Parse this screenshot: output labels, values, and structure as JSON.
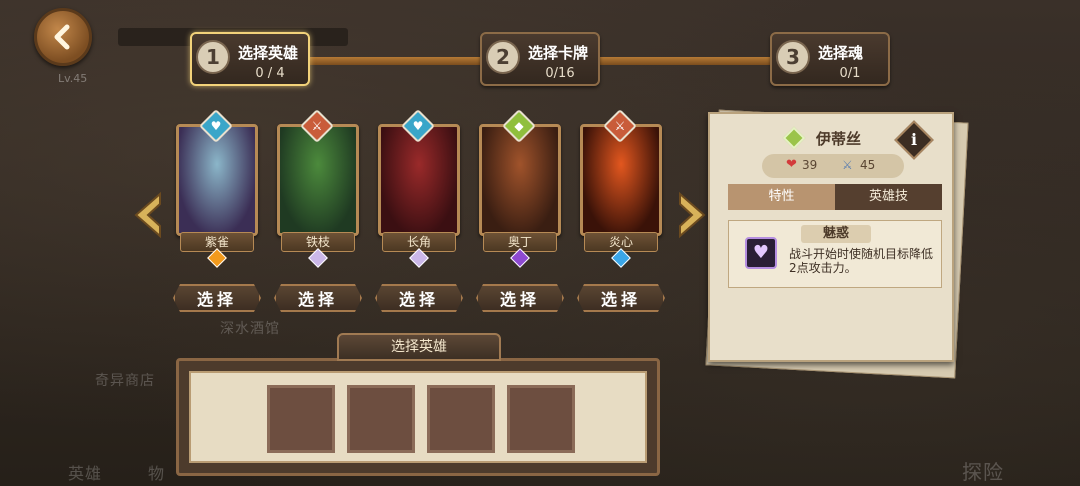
{
  "background": {
    "tavern": "深水酒馆",
    "shop": "奇异商店",
    "bottom_left": "英雄",
    "bottom_left2": "物",
    "bottom_right": "探险",
    "level": "Lv.45"
  },
  "steps": [
    {
      "num": "1",
      "title": "选择英雄",
      "count": "0 / 4"
    },
    {
      "num": "2",
      "title": "选择卡牌",
      "count": "0/16"
    },
    {
      "num": "3",
      "title": "选择魂",
      "count": "0/1"
    }
  ],
  "heroes": [
    {
      "name": "紫雀",
      "class_icon": "heart-icon",
      "class_color": "#3aa6c9",
      "gem_color": "#f29a1c",
      "art": [
        "#3b2e55",
        "#8bb6c9"
      ]
    },
    {
      "name": "铁枝",
      "class_icon": "sword-icon",
      "class_color": "#c95c3a",
      "gem_color": "#cbb7e8",
      "art": [
        "#1f3a22",
        "#4c8a3c"
      ]
    },
    {
      "name": "长角",
      "class_icon": "heart-icon",
      "class_color": "#3aa6c9",
      "gem_color": "#cbb7e8",
      "art": [
        "#3b0f12",
        "#9a2a2a"
      ]
    },
    {
      "name": "奥丁",
      "class_icon": "shield-icon",
      "class_color": "#8fbf3d",
      "gem_color": "#8e4ad1",
      "art": [
        "#3a1e12",
        "#a0532b"
      ]
    },
    {
      "name": "炎心",
      "class_icon": "sword-icon",
      "class_color": "#c95c3a",
      "gem_color": "#3aa6e8",
      "art": [
        "#3a1208",
        "#e2571f"
      ]
    }
  ],
  "select_label": "选择",
  "tray": {
    "title": "选择英雄",
    "slots": 4
  },
  "panel": {
    "hero_name": "伊蒂丝",
    "info_label": "i",
    "health": "39",
    "attack": "45",
    "tabs": [
      "特性",
      "英雄技"
    ],
    "active_tab": 0,
    "skill": {
      "title": "魅惑",
      "icon": "charm-icon",
      "description": "战斗开始时使随机目标降低2点攻击力。"
    }
  },
  "colors": {
    "accent_gold": "#f2d27a",
    "frame_bronze": "#b68a55",
    "parchment": "#e8dfca"
  }
}
